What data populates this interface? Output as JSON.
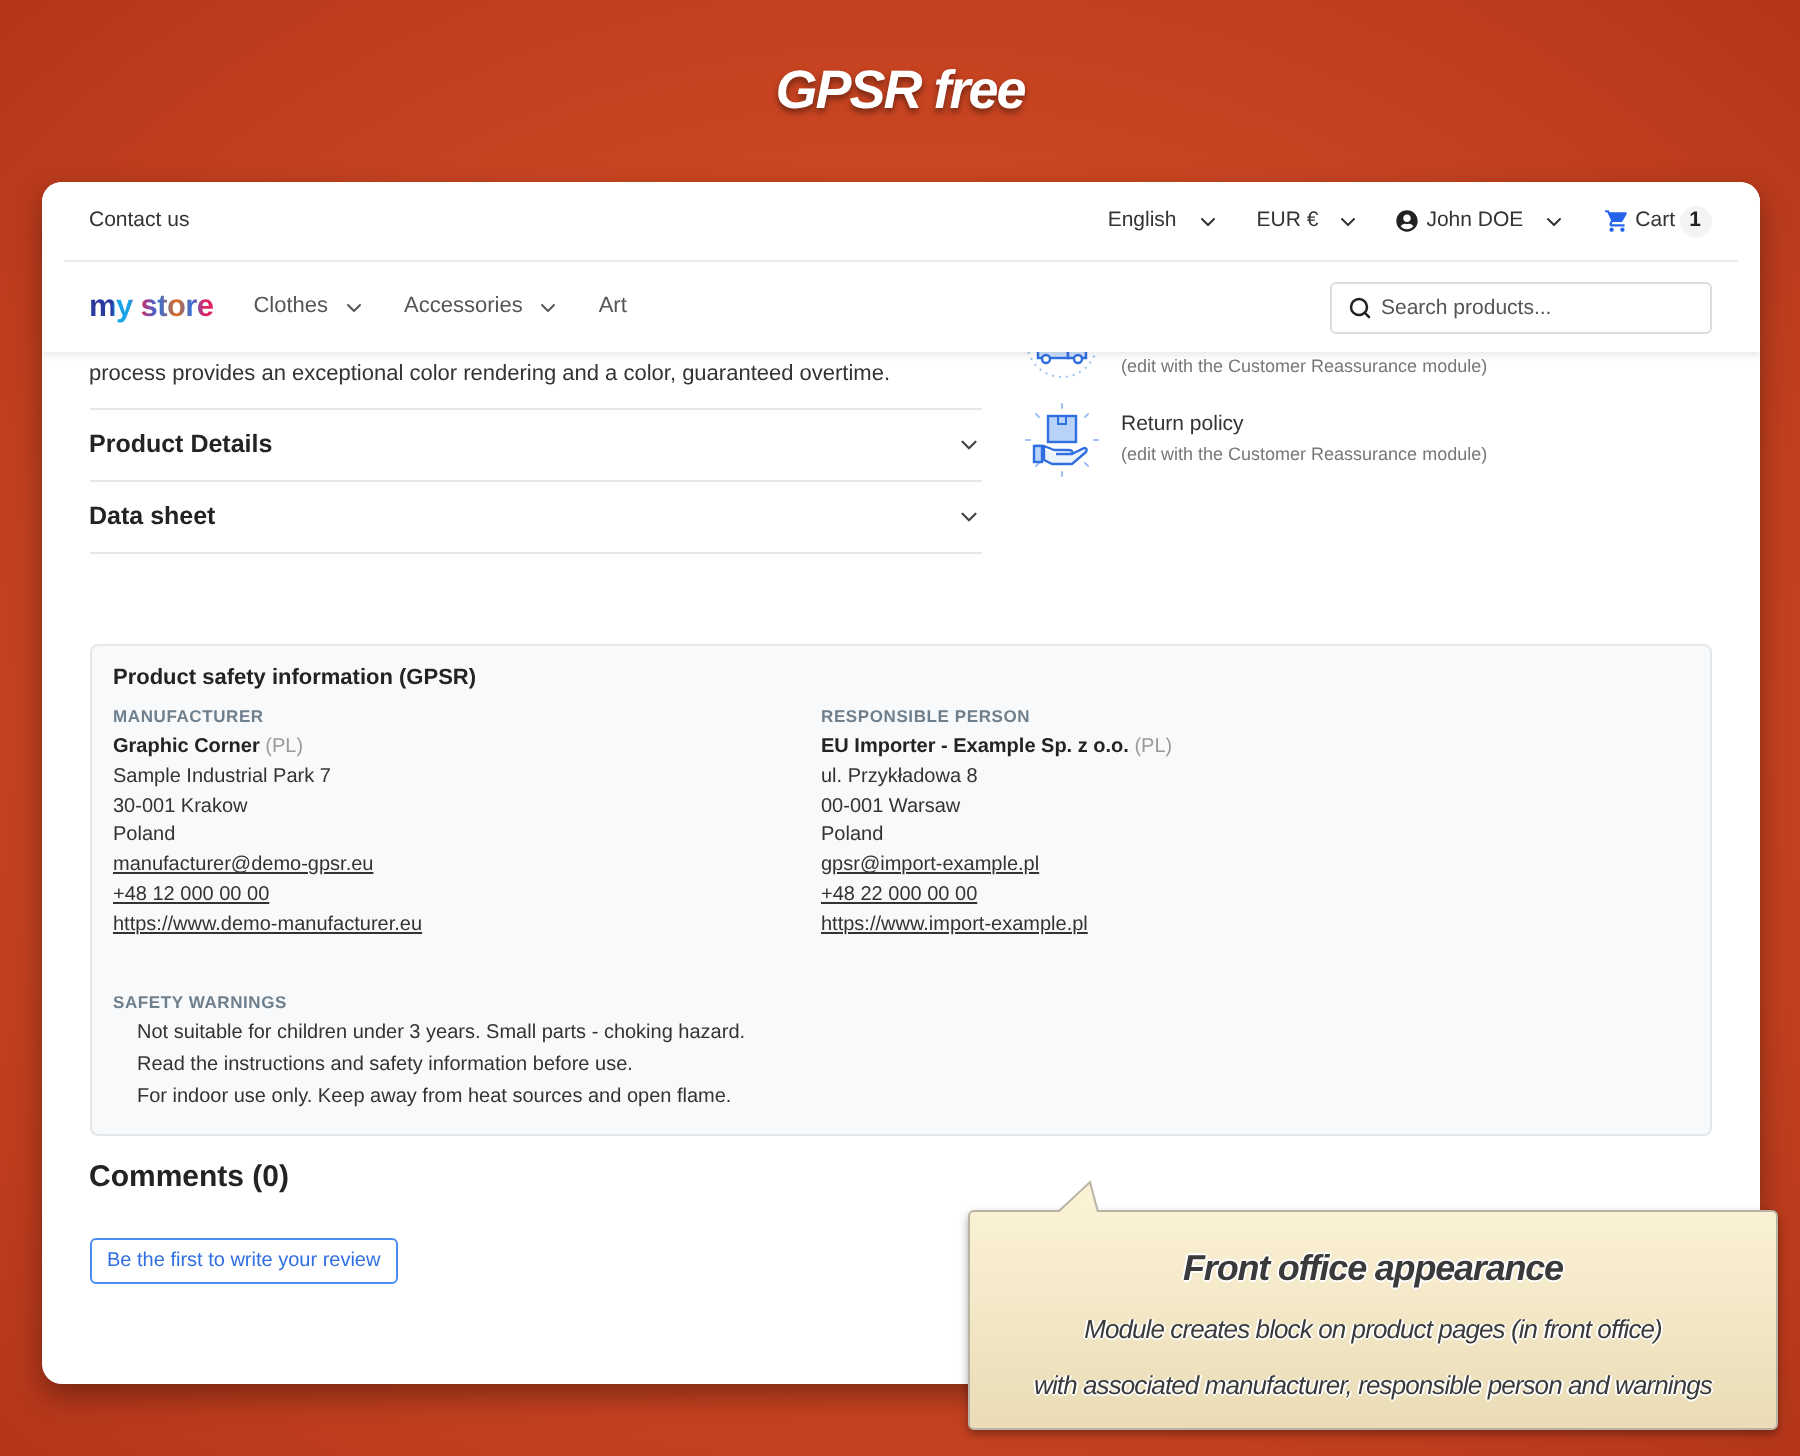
{
  "banner": {
    "title": "GPSR free"
  },
  "top_bar": {
    "contact": "Contact us",
    "language": "English",
    "currency": "EUR €",
    "user": "John DOE",
    "cart": {
      "label": "Cart",
      "count": "1"
    }
  },
  "nav": {
    "logo": "my store",
    "menu": [
      {
        "label": "Clothes",
        "has_submenu": true
      },
      {
        "label": "Accessories",
        "has_submenu": true
      },
      {
        "label": "Art",
        "has_submenu": false
      }
    ],
    "search": {
      "placeholder": "Search products..."
    }
  },
  "description": {
    "text": "process provides an exceptional color rendering and a color, guaranteed overtime."
  },
  "accordions": [
    {
      "title": "Product Details",
      "expanded": false
    },
    {
      "title": "Data sheet",
      "expanded": false
    }
  ],
  "reassurance": [
    {
      "subtitle": "(edit with the Customer Reassurance module)"
    },
    {
      "title": "Return policy",
      "subtitle": "(edit with the Customer Reassurance module)"
    }
  ],
  "gpsr": {
    "title": "Product safety information (GPSR)",
    "parties": [
      {
        "heading": "MANUFACTURER",
        "name": "Graphic Corner",
        "country": "(PL)",
        "address": [
          "Sample Industrial Park 7",
          "30-001 Krakow",
          "Poland"
        ],
        "email": "manufacturer@demo-gpsr.eu",
        "phone": "+48 12 000 00 00",
        "website": "https://www.demo-manufacturer.eu"
      },
      {
        "heading": "RESPONSIBLE PERSON",
        "name": "EU Importer - Example Sp. z o.o.",
        "country": "(PL)",
        "address": [
          "ul. Przykładowa 8",
          "00-001 Warsaw",
          "Poland"
        ],
        "email": "gpsr@import-example.pl",
        "phone": "+48 22 000 00 00",
        "website": "https://www.import-example.pl"
      }
    ],
    "warnings": {
      "heading": "SAFETY WARNINGS",
      "items": [
        "Not suitable for children under 3 years. Small parts - choking hazard.",
        "Read the instructions and safety information before use.",
        "For indoor use only. Keep away from heat sources and open flame."
      ]
    }
  },
  "comments": {
    "title": "Comments (0)",
    "review_button": "Be the first to write your review"
  },
  "callout": {
    "title": "Front office appearance",
    "lines": [
      "Module creates block on product pages (in front office)",
      "with associated manufacturer, responsible person and warnings"
    ]
  }
}
